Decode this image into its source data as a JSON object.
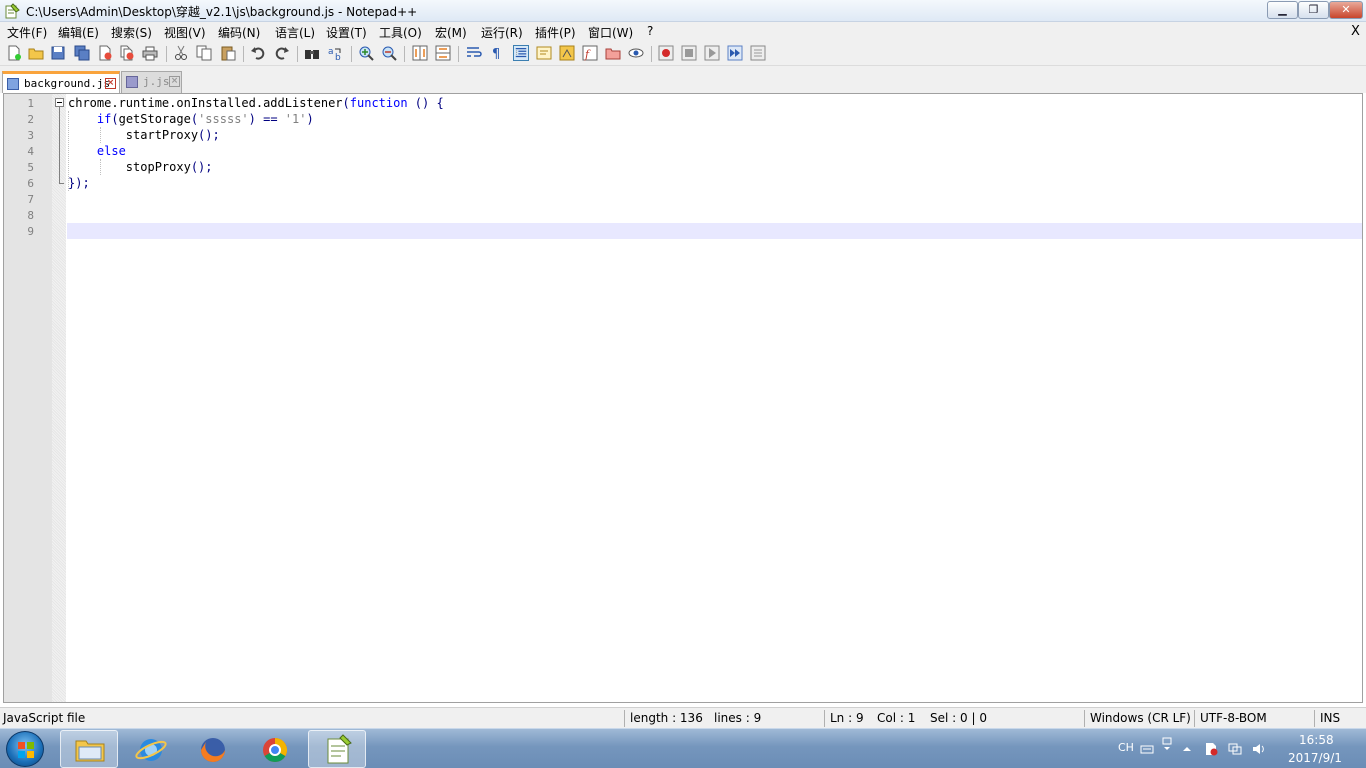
{
  "window": {
    "title": "C:\\Users\\Admin\\Desktop\\穿越_v2.1\\js\\background.js - Notepad++",
    "min_label": "▁",
    "max_label": "❐",
    "close_label": "✕"
  },
  "menu": {
    "items": [
      "文件(F)",
      "编辑(E)",
      "搜索(S)",
      "视图(V)",
      "编码(N)",
      "语言(L)",
      "设置(T)",
      "工具(O)",
      "宏(M)",
      "运行(R)",
      "插件(P)",
      "窗口(W)",
      "?"
    ],
    "close_doc": "X"
  },
  "toolbar": {
    "icons": [
      "new-file-icon",
      "open-file-icon",
      "save-icon",
      "save-all-icon",
      "close-icon",
      "close-all-icon",
      "print-icon",
      "cut-icon",
      "copy-icon",
      "paste-icon",
      "undo-icon",
      "redo-icon",
      "find-icon",
      "replace-icon",
      "zoom-in-icon",
      "zoom-out-icon",
      "sync-vertical-icon",
      "sync-horizontal-icon",
      "word-wrap-icon",
      "show-all-chars-icon",
      "indent-guide-icon",
      "user-language-icon",
      "doc-map-icon",
      "function-list-icon",
      "folder-workspace-icon",
      "monitoring-icon",
      "record-macro-icon",
      "stop-macro-icon",
      "play-macro-icon",
      "run-macro-multiple-icon",
      "save-macro-icon"
    ]
  },
  "tabs": [
    {
      "label": "background.js",
      "active": true
    },
    {
      "label": "j.js",
      "active": false
    }
  ],
  "editor": {
    "line_numbers": [
      "1",
      "2",
      "3",
      "4",
      "5",
      "6",
      "7",
      "8",
      "9"
    ],
    "lines": [
      [
        {
          "t": "chrome.runtime.onInstalled.addListener",
          "c": ""
        },
        {
          "t": "(",
          "c": "op"
        },
        {
          "t": "function",
          "c": "kw"
        },
        {
          "t": " () {",
          "c": "op"
        }
      ],
      [
        {
          "t": "    ",
          "c": ""
        },
        {
          "t": "if",
          "c": "kw"
        },
        {
          "t": "(",
          "c": "op"
        },
        {
          "t": "getStorage",
          "c": ""
        },
        {
          "t": "(",
          "c": "op"
        },
        {
          "t": "'sssss'",
          "c": "str"
        },
        {
          "t": ") == ",
          "c": "op"
        },
        {
          "t": "'1'",
          "c": "str"
        },
        {
          "t": ")",
          "c": "op"
        }
      ],
      [
        {
          "t": "        startProxy",
          "c": ""
        },
        {
          "t": "();",
          "c": "op"
        }
      ],
      [
        {
          "t": "    ",
          "c": ""
        },
        {
          "t": "else",
          "c": "kw"
        }
      ],
      [
        {
          "t": "        stopProxy",
          "c": ""
        },
        {
          "t": "();",
          "c": "op"
        }
      ],
      [
        {
          "t": "});",
          "c": "op"
        }
      ],
      [],
      [],
      []
    ]
  },
  "statusbar": {
    "file_type": "JavaScript file",
    "length": "length : 136",
    "lines": "lines : 9",
    "ln": "Ln : 9",
    "col": "Col : 1",
    "sel": "Sel : 0 | 0",
    "eol": "Windows (CR LF)",
    "encoding": "UTF-8-BOM",
    "mode": "INS"
  },
  "taskbar": {
    "apps": [
      "explorer-icon",
      "internet-explorer-icon",
      "firefox-icon",
      "chrome-icon",
      "notepadpp-icon"
    ],
    "tray_lang": "CH",
    "time": "16:58",
    "date": "2017/9/1"
  },
  "colors": {
    "keyword": "#0000ff",
    "string": "#808080",
    "operator": "#000080",
    "current_line": "#e8e8ff",
    "active_tab_accent": "#f9a33c"
  }
}
